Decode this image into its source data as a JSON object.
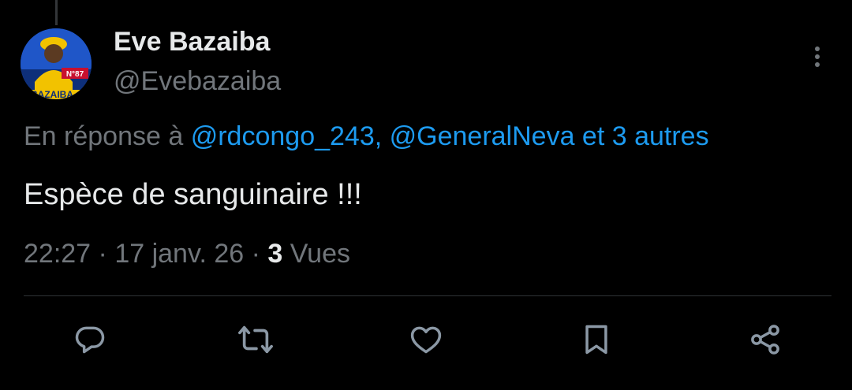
{
  "tweet": {
    "author_name": "Eve Bazaiba",
    "author_handle": "@Evebazaiba",
    "avatar_badge_text": "N°87",
    "avatar_banner_text": "BAZAIBA",
    "reply_prefix": "En réponse à",
    "reply_mentions": "@rdcongo_243, @GeneralNeva et 3 autres",
    "text": "Espèce de sanguinaire !!!",
    "time": "22:27",
    "separator": "·",
    "date": "17 janv. 26",
    "views_count": "3",
    "views_label": "Vues"
  },
  "actions": [
    {
      "icon": "reply-icon"
    },
    {
      "icon": "retweet-icon"
    },
    {
      "icon": "like-icon"
    },
    {
      "icon": "bookmark-icon"
    },
    {
      "icon": "share-icon"
    }
  ],
  "colors": {
    "background": "#000000",
    "primary_text": "#e7e9ea",
    "secondary_text": "#71767b",
    "link": "#1d9bf0",
    "divider": "#2f3336"
  }
}
